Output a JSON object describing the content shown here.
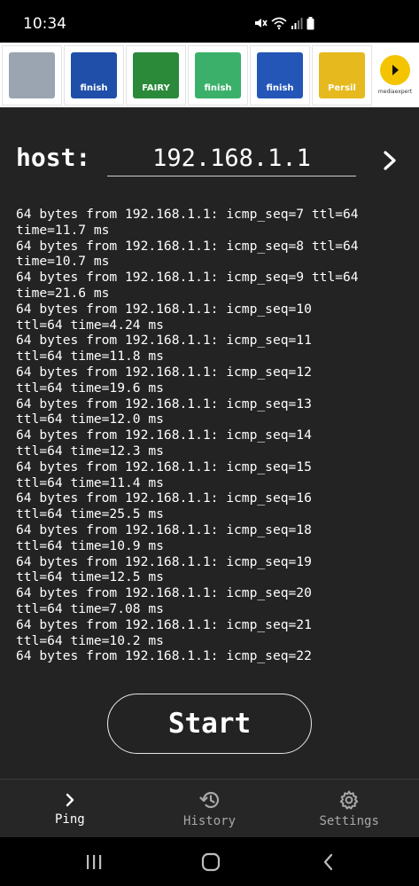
{
  "status_bar": {
    "time": "10:34",
    "icons": [
      "mute-icon",
      "wifi-icon",
      "signal-icon",
      "battery-icon"
    ]
  },
  "ad": {
    "tiles": [
      {
        "icon": "product-image",
        "color": "#9aa5b1",
        "label": ""
      },
      {
        "icon": "product-image",
        "color": "#1f4fa8",
        "label": "finish"
      },
      {
        "icon": "product-image",
        "color": "#2a8a3a",
        "label": "FAIRY"
      },
      {
        "icon": "product-image",
        "color": "#3bb06a",
        "label": "finish"
      },
      {
        "icon": "product-image",
        "color": "#2456b8",
        "label": "finish"
      },
      {
        "icon": "product-image",
        "color": "#e6b91e",
        "label": "Persil"
      }
    ],
    "brand": "mediaexpert"
  },
  "host": {
    "label": "host:",
    "value": "192.168.1.1"
  },
  "output_lines": [
    "64 bytes from 192.168.1.1: icmp_seq=7 ttl=64",
    "time=11.7 ms",
    "64 bytes from 192.168.1.1: icmp_seq=8 ttl=64",
    "time=10.7 ms",
    "64 bytes from 192.168.1.1: icmp_seq=9 ttl=64",
    "time=21.6 ms",
    "64 bytes from 192.168.1.1: icmp_seq=10",
    "ttl=64 time=4.24 ms",
    "64 bytes from 192.168.1.1: icmp_seq=11",
    "ttl=64 time=11.8 ms",
    "64 bytes from 192.168.1.1: icmp_seq=12",
    "ttl=64 time=19.6 ms",
    "64 bytes from 192.168.1.1: icmp_seq=13",
    "ttl=64 time=12.0 ms",
    "64 bytes from 192.168.1.1: icmp_seq=14",
    "ttl=64 time=12.3 ms",
    "64 bytes from 192.168.1.1: icmp_seq=15",
    "ttl=64 time=11.4 ms",
    "64 bytes from 192.168.1.1: icmp_seq=16",
    "ttl=64 time=25.5 ms",
    "64 bytes from 192.168.1.1: icmp_seq=18",
    "ttl=64 time=10.9 ms",
    "64 bytes from 192.168.1.1: icmp_seq=19",
    "ttl=64 time=12.5 ms",
    "64 bytes from 192.168.1.1: icmp_seq=20",
    "ttl=64 time=7.08 ms",
    "64 bytes from 192.168.1.1: icmp_seq=21",
    "ttl=64 time=10.2 ms",
    "64 bytes from 192.168.1.1: icmp_seq=22"
  ],
  "start_button": {
    "label": "Start"
  },
  "nav": {
    "items": [
      {
        "label": "Ping",
        "icon": "chevron-right-icon",
        "active": true
      },
      {
        "label": "History",
        "icon": "history-icon",
        "active": false
      },
      {
        "label": "Settings",
        "icon": "gear-icon",
        "active": false
      }
    ]
  },
  "system_nav": {
    "buttons": [
      "recent-apps-icon",
      "home-icon",
      "back-icon"
    ]
  },
  "colors": {
    "background": "#232323",
    "nav_background": "#262626",
    "text": "#ffffff",
    "inactive_text": "#a8a8a8",
    "ad_accent": "#f4c400"
  }
}
